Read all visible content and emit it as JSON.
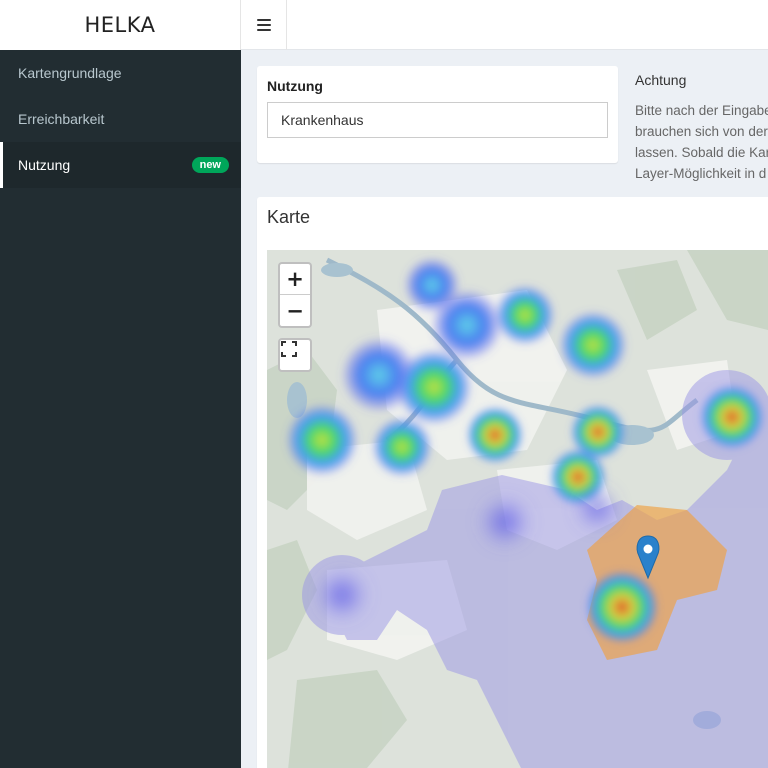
{
  "app": {
    "title": "HELKA"
  },
  "header": {
    "toggle_icon": "hamburger-menu-icon"
  },
  "sidebar": {
    "items": [
      {
        "label": "Kartengrundlage"
      },
      {
        "label": "Erreichbarkeit"
      },
      {
        "label": "Nutzung",
        "badge": "new",
        "active": true
      }
    ]
  },
  "nutzung": {
    "label": "Nutzung",
    "value": "Krankenhaus"
  },
  "notice": {
    "title": "Achtung",
    "lines": [
      "Bitte nach der Eingabe",
      "brauchen sich von der",
      "lassen. Sobald die Kar",
      "Layer-Möglichkeit in d"
    ]
  },
  "map": {
    "title": "Karte",
    "zoom_in": "+",
    "zoom_out": "−",
    "fullscreen_icon": "fullscreen-icon",
    "marker_icon": "location-pin-icon",
    "colors": {
      "marker": "#2a81cb",
      "service_area": "#f0a040",
      "coverage": "#9b96e6"
    }
  }
}
